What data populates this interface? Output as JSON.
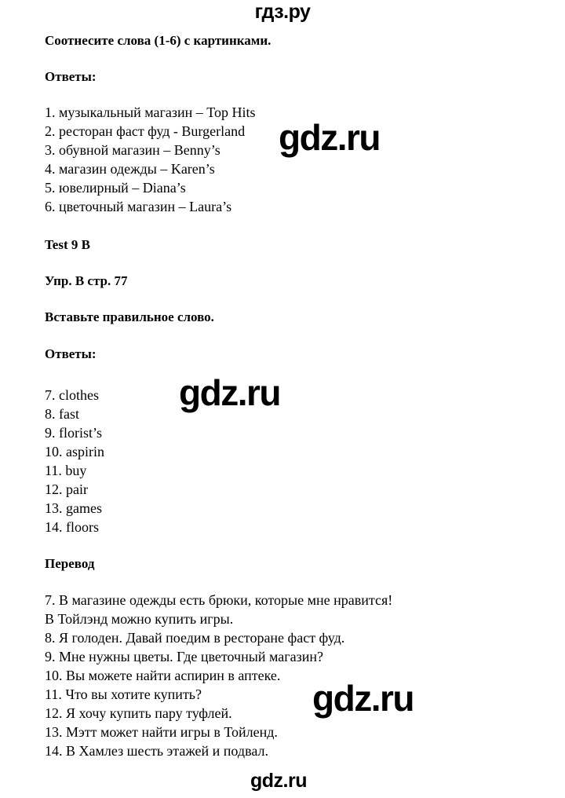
{
  "site": {
    "logo_top": "гдз.ру",
    "watermarks": [
      "gdz.ru",
      "gdz.ru",
      "gdz.ru",
      "gdz.ru"
    ]
  },
  "task": {
    "title": "Соотнесите слова (1-6) с картинками.",
    "answers_heading": "Ответы:",
    "answers": [
      "1. музыкальный магазин – Top Hits",
      "2. ресторан фаст фуд - Burgerland",
      "3. обувной магазин – Benny’s",
      "4. магазин одежды – Karen’s",
      "5. ювелирный – Diana’s",
      "6. цветочный магазин – Laura’s"
    ]
  },
  "test": {
    "label": "Test 9 B",
    "exercise": "Упр. B стр. 77",
    "instruction": "Вставьте правильное слово.",
    "answers_heading": "Ответы:",
    "answers": [
      "7. clothes",
      "8. fast",
      "9. florist’s",
      "10. aspirin",
      "11. buy",
      "12. pair",
      "13. games",
      "14. floors"
    ]
  },
  "translation": {
    "heading": "Перевод",
    "lines": [
      "7. В магазине одежды есть брюки, которые мне нравится!",
      "В Тойлэнд можно купить игры.",
      "8. Я голоден. Давай поедим в ресторане фаст фуд.",
      "9. Мне нужны цветы. Где цветочный магазин?",
      "10. Вы можете найти аспирин в аптеке.",
      "11. Что вы хотите купить?",
      "12. Я хочу купить пару туфлей.",
      "13. Мэтт может найти игры в Тойленд.",
      "14. В Хамлез шесть этажей и подвал."
    ]
  }
}
